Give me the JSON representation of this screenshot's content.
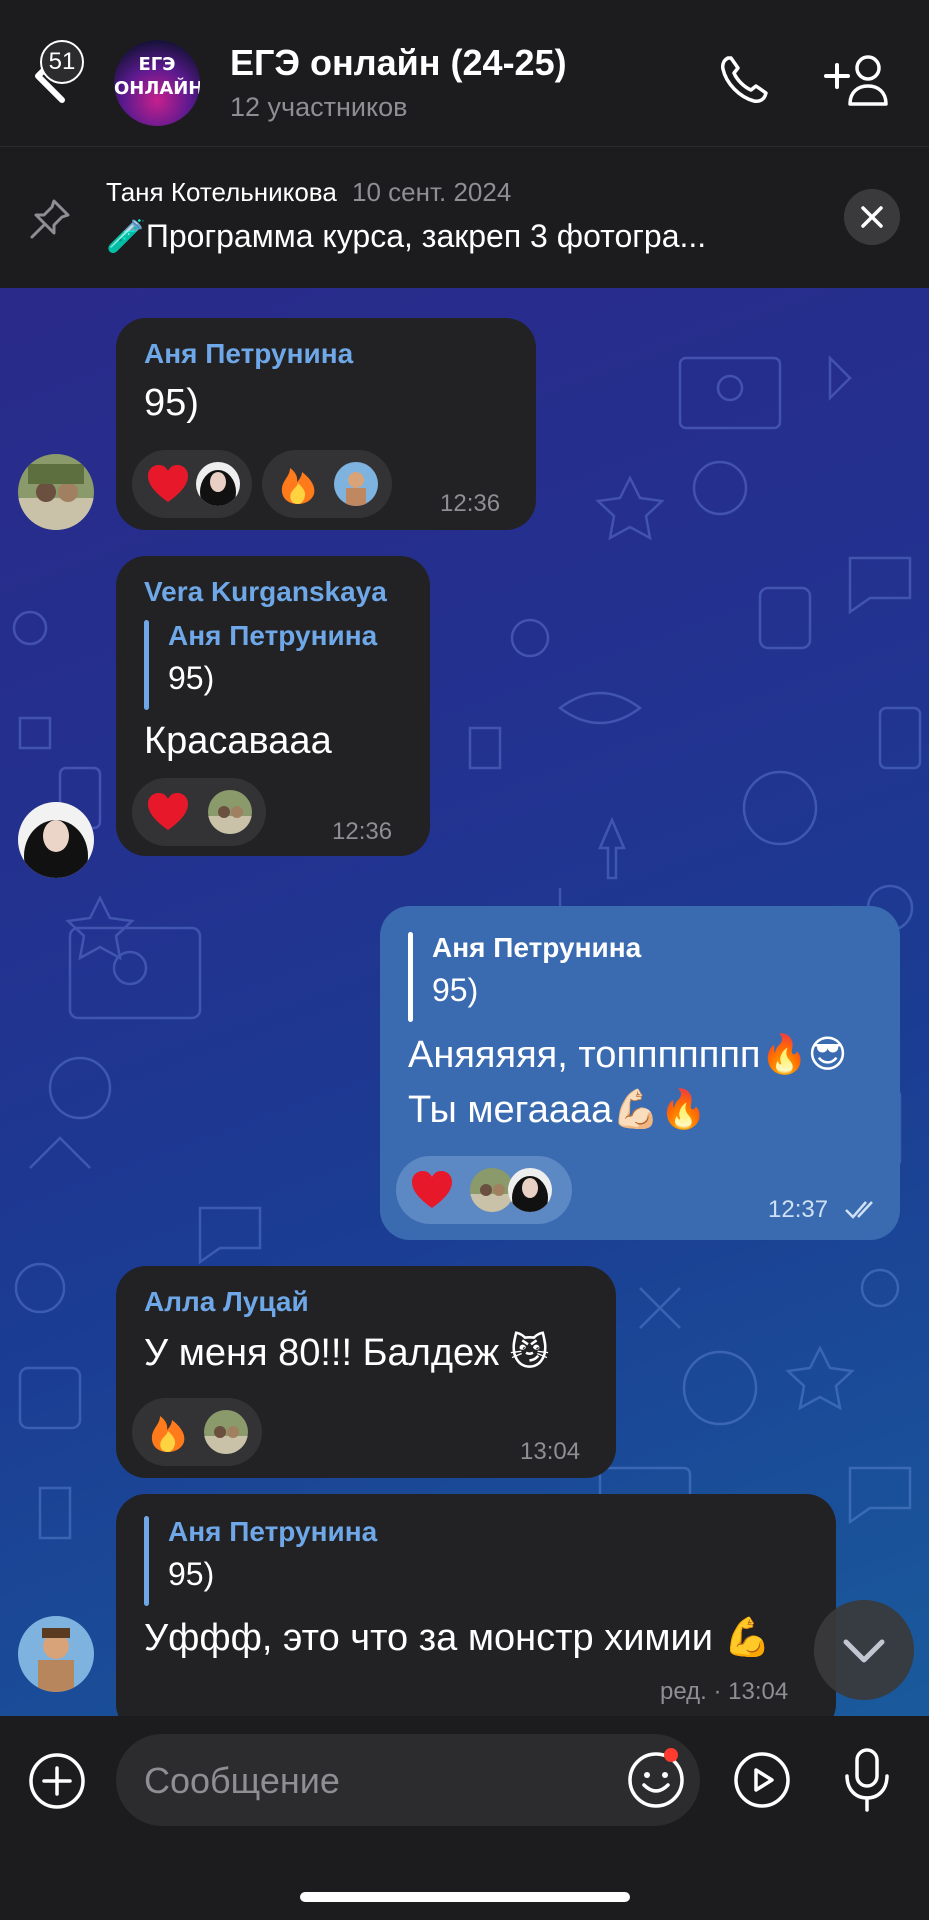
{
  "header": {
    "back_count": "51",
    "avatar_line1": "ЕГЭ",
    "avatar_line2": "ОНЛАЙН",
    "title": "ЕГЭ онлайн (24-25)",
    "subtitle": "12 участников",
    "icons": [
      "phone-icon",
      "add-user-icon"
    ]
  },
  "pinned": {
    "author": "Таня Котельникова",
    "date": "10 сент. 2024",
    "text": "🧪Программа курса, закреп 3 фотогра..."
  },
  "messages": [
    {
      "sender": "Аня Петрунина",
      "text": "95)",
      "time": "12:36",
      "reactions": [
        "heart",
        "fire"
      ]
    },
    {
      "sender": "Vera Kurganskaya",
      "reply_name": "Аня Петрунина",
      "reply_text": "95)",
      "text": "Красаваaa",
      "time": "12:36",
      "reactions": [
        "heart"
      ]
    },
    {
      "outgoing": true,
      "reply_name": "Аня Петрунина",
      "reply_text": "95)",
      "line1": "Аняяяяя, топпппппп🔥😎",
      "line2": "Ты мегаааа💪🏻🔥",
      "time": "12:37",
      "reactions": [
        "heart"
      ]
    },
    {
      "sender": "Алла Луцай",
      "text": "У меня 80!!! Балдеж 😼",
      "time": "13:04",
      "reactions": [
        "fire"
      ]
    },
    {
      "reply_name": "Аня Петрунина",
      "reply_text": "95)",
      "text": "Уффф, это что за монстр химии 💪",
      "time": "ред. · 13:04"
    }
  ],
  "input": {
    "placeholder": "Сообщение"
  },
  "colors": {
    "accent": "#6ea8e8",
    "outgoing_bubble": "#3a6bb0",
    "incoming_bubble": "#222224",
    "unread_dot": "#ff3b30"
  }
}
